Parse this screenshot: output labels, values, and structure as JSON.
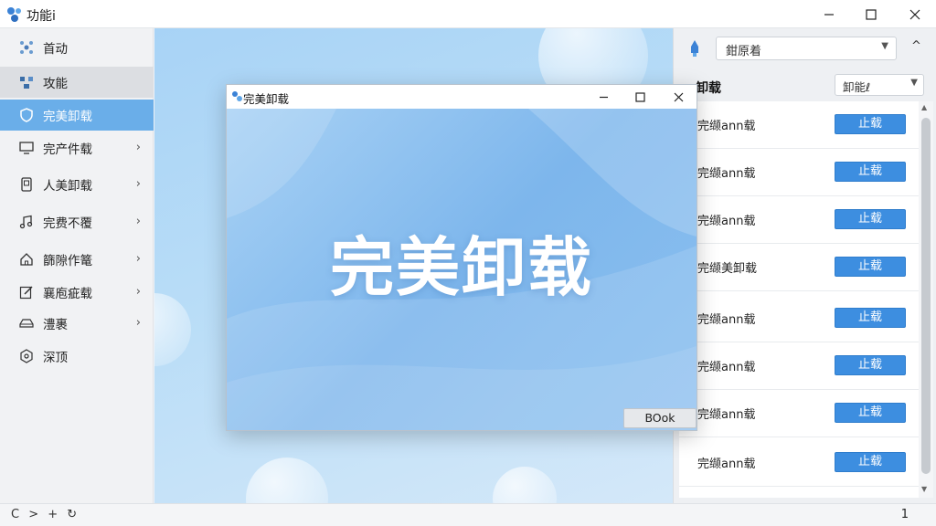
{
  "app": {
    "title": "功能ⅰ"
  },
  "sidebar": {
    "items": [
      {
        "label": "首动",
        "icon": "network-icon",
        "chevron": false
      },
      {
        "label": "攻能",
        "icon": "nodes-icon",
        "chevron": false
      },
      {
        "label": "完美卸载",
        "icon": "shield-icon",
        "chevron": false
      },
      {
        "label": "完产件载",
        "icon": "monitor-icon",
        "chevron": true
      },
      {
        "label": "人美卸载",
        "icon": "tablet-icon",
        "chevron": true
      },
      {
        "label": "完费不覆",
        "icon": "music-icon",
        "chevron": true
      },
      {
        "label": "篩隙作篭",
        "icon": "home-icon",
        "chevron": true
      },
      {
        "label": "襄庖疵载",
        "icon": "edit-icon",
        "chevron": true
      },
      {
        "label": "澧裹",
        "icon": "drive-icon",
        "chevron": true
      },
      {
        "label": "深顶",
        "icon": "settings-hex-icon",
        "chevron": false
      }
    ]
  },
  "bottom": {
    "tools": "C > + ↻",
    "page_number": "1"
  },
  "right_panel": {
    "select_value": "鉗原着",
    "header_label": "卸载",
    "header_select_value": "卸能ℓ",
    "rows": [
      {
        "name": "完缬ann载",
        "button": "止载"
      },
      {
        "name": "完缬ann载",
        "button": "止载"
      },
      {
        "name": "完缬ann载",
        "button": "止载"
      },
      {
        "name": "完缬美卸载",
        "button": "止载"
      },
      {
        "name": "完缬ann载",
        "button": "止载"
      },
      {
        "name": "完缬ann载",
        "button": "止载"
      },
      {
        "name": "完缬ann载",
        "button": "止载"
      },
      {
        "name": "完缬ann载",
        "button": "止载"
      }
    ]
  },
  "dialog": {
    "title": "完美卸载",
    "heading": "完美卸载",
    "button_label": "BOok"
  },
  "colors": {
    "accent": "#6aaee9",
    "button_blue": "#3d8ee0",
    "dialog_gradient_start": "#a9d2f5",
    "dialog_gradient_end": "#7db6ec"
  }
}
